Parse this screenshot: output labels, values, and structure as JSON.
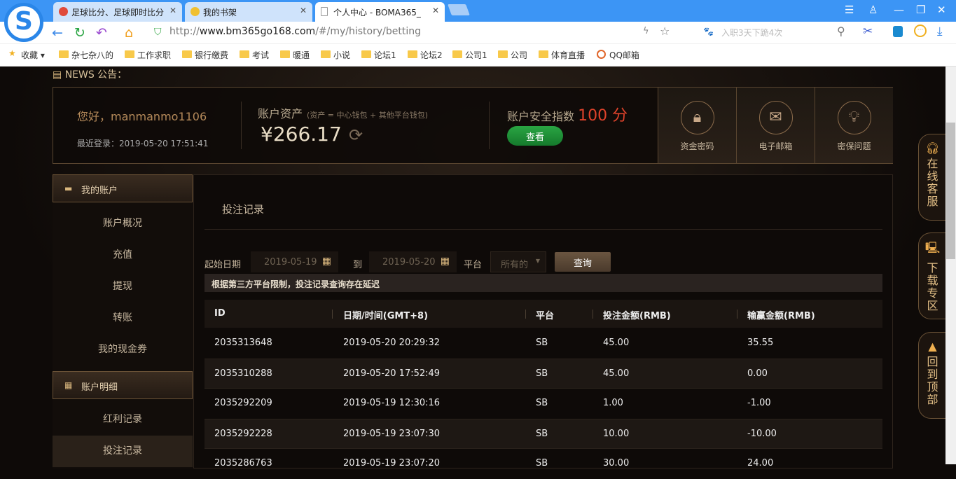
{
  "browser": {
    "tabs": [
      {
        "label": "足球比分、足球即时比分"
      },
      {
        "label": "我的书架"
      },
      {
        "label": "个人中心 - BOMA365_"
      }
    ],
    "url_prefix": "http://",
    "url_domain": "www.bm365go168.com",
    "url_path": "/#/my/history/betting",
    "search_placeholder": "入职3天下跪4次",
    "bookmarks": [
      "收藏",
      "杂七杂八的",
      "工作求职",
      "银行缴费",
      "考试",
      "暖通",
      "小说",
      "论坛1",
      "论坛2",
      "公司1",
      "公司",
      "体育直播",
      "QQ邮箱"
    ]
  },
  "news": {
    "label": "NEWS 公告："
  },
  "account": {
    "greeting": "您好，manmanmo1106",
    "last_login": "最近登录：2019-05-20 17:51:41",
    "asset_label": "账户资产",
    "asset_note": "(资产 = 中心钱包 + 其他平台钱包)",
    "amount": "¥266.17",
    "security_label": "账户安全指数",
    "security_score": "100 分",
    "view_button": "查看",
    "security_items": [
      "资金密码",
      "电子邮箱",
      "密保问题"
    ]
  },
  "sidebar": {
    "section1": "我的账户",
    "items1": [
      "账户概况",
      "充值",
      "提现",
      "转账",
      "我的现金券"
    ],
    "section2": "账户明细",
    "items2": [
      "红利记录",
      "投注记录"
    ]
  },
  "main": {
    "title": "投注记录",
    "start_label": "起始日期",
    "start_date": "2019-05-19",
    "to_label": "到",
    "end_date": "2019-05-20",
    "platform_label": "平台",
    "platform_value": "所有的",
    "query_button": "查询",
    "notice": "根据第三方平台限制，投注记录查询存在延迟",
    "columns": [
      "ID",
      "日期/时间(GMT+8)",
      "平台",
      "投注金额(RMB)",
      "输赢金额(RMB)"
    ],
    "rows": [
      [
        "2035313648",
        "2019-05-20 20:29:32",
        "SB",
        "45.00",
        "35.55"
      ],
      [
        "2035310288",
        "2019-05-20 17:52:49",
        "SB",
        "45.00",
        "0.00"
      ],
      [
        "2035292209",
        "2019-05-19 12:30:16",
        "SB",
        "1.00",
        "-1.00"
      ],
      [
        "2035292228",
        "2019-05-19 23:07:30",
        "SB",
        "10.00",
        "-10.00"
      ],
      [
        "2035286763",
        "2019-05-19 23:07:20",
        "SB",
        "30.00",
        "24.00"
      ]
    ]
  },
  "float": {
    "service": "在线客服",
    "download": "下载专区",
    "top": "回到顶部"
  }
}
